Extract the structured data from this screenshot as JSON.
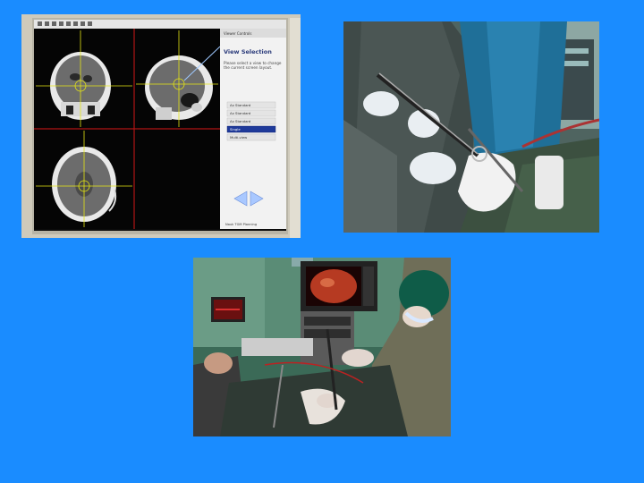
{
  "slide": {
    "background_color": "#1a8cff"
  },
  "monitor_photo": {
    "panel_title": "Viewer Controls",
    "heading": "View Selection",
    "description": "Please select a view to change the current screen layout.",
    "view_options": [
      "Ax Standard",
      "Ax Standard",
      "Ax Standard",
      "Single",
      "Multi-view"
    ],
    "selected_option_index": 3,
    "footer_brand": "Nauk TGM Planning"
  }
}
